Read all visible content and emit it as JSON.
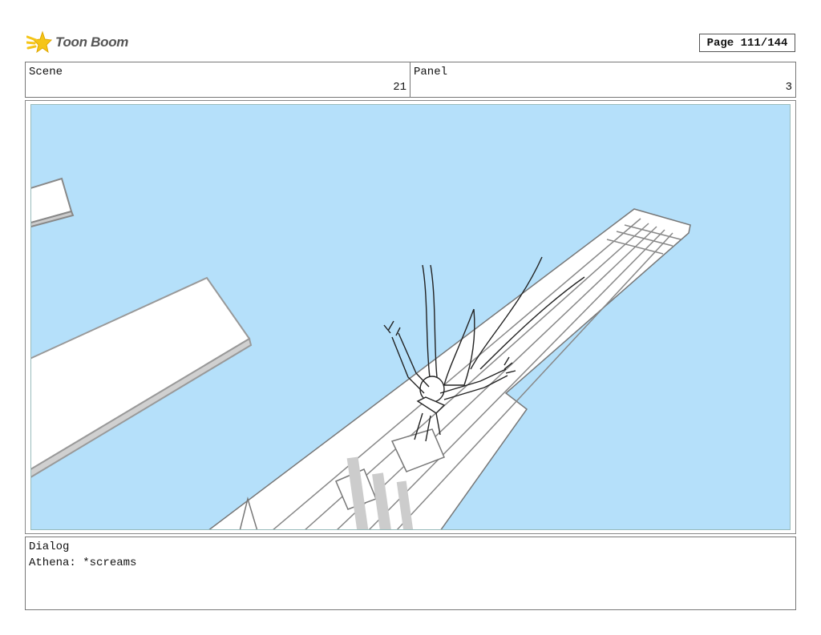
{
  "header": {
    "logo_text": "Toon Boom",
    "page_label": "Page 111/144"
  },
  "scene": {
    "label": "Scene",
    "value": "21"
  },
  "panel": {
    "label": "Panel",
    "value": "3"
  },
  "dialog": {
    "label": "Dialog",
    "text": "Athena: *screams"
  },
  "colors": {
    "sky": "#b5e0fa",
    "border": "#777777",
    "logo_star": "#f5c518"
  },
  "icons": {
    "logo": "toon-boom-star-icon"
  }
}
